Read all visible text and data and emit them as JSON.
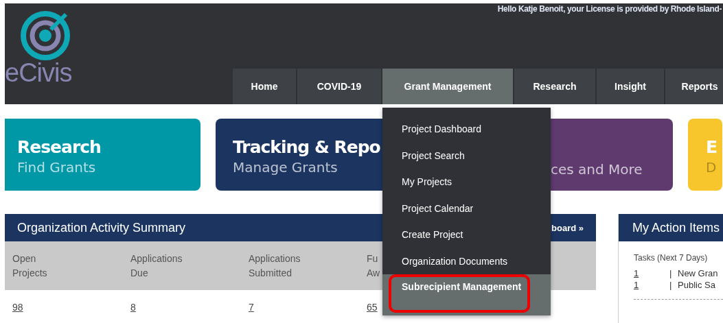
{
  "header": {
    "greeting": "Hello Katje Benoit, your License is provided by Rhode Island-",
    "logo_text": "eCivis"
  },
  "nav_tabs": [
    {
      "label": "Home",
      "selected": false
    },
    {
      "label": "COVID-19",
      "selected": false
    },
    {
      "label": "Grant Management",
      "selected": true
    },
    {
      "label": "Research",
      "selected": false
    },
    {
      "label": "Insight",
      "selected": false
    },
    {
      "label": "Reports",
      "selected": false
    }
  ],
  "dropdown": {
    "items": [
      {
        "label": "Project Dashboard",
        "selected": false,
        "outlined": false
      },
      {
        "label": "Project Search",
        "selected": false,
        "outlined": false
      },
      {
        "label": "My Projects",
        "selected": false,
        "outlined": false
      },
      {
        "label": "Project Calendar",
        "selected": false,
        "outlined": false
      },
      {
        "label": "Create Project",
        "selected": false,
        "outlined": false
      },
      {
        "label": "Organization Documents",
        "selected": false,
        "outlined": false
      },
      {
        "label": "Subrecipient Management",
        "selected": true,
        "outlined": true
      }
    ]
  },
  "cards": [
    {
      "title": "Research",
      "subtitle": "Find Grants",
      "color": "#0097a7"
    },
    {
      "title": "Tracking & Repo",
      "subtitle": "Manage Grants",
      "color": "#1c3560"
    },
    {
      "subtitle": "ces and More",
      "color": "#5e3a6e"
    },
    {
      "title": "E",
      "subtitle": "D",
      "color": "#f7c52c"
    }
  ],
  "summary": {
    "title": "Organization Activity Summary",
    "link": "board »",
    "columns": [
      {
        "label": "Open Projects",
        "value": "98"
      },
      {
        "label": "Applications Due",
        "value": "8"
      },
      {
        "label": "Applications Submitted",
        "value": "7"
      },
      {
        "label": "Fu Aw",
        "value": "65"
      }
    ]
  },
  "action_items": {
    "title": "My Action Items",
    "subtitle": "Tasks (Next 7 Days)",
    "tasks": [
      {
        "count": "1",
        "divider": "|",
        "label": "New Gran"
      },
      {
        "count": "1",
        "divider": "|",
        "label": "Public Sa"
      }
    ]
  }
}
